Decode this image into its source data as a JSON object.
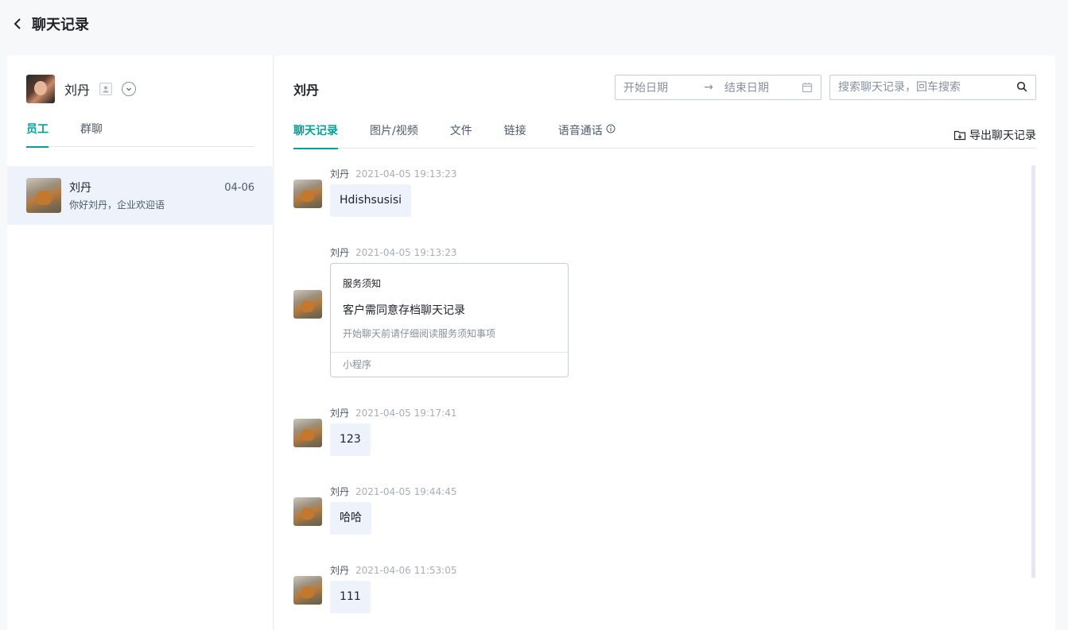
{
  "header": {
    "title": "聊天记录"
  },
  "sidebar": {
    "user_name": "刘丹",
    "tabs": [
      {
        "label": "员工",
        "active": true
      },
      {
        "label": "群聊",
        "active": false
      }
    ],
    "contacts": [
      {
        "name": "刘丹",
        "date": "04-06",
        "preview": "你好刘丹，企业欢迎语"
      }
    ]
  },
  "chat": {
    "title": "刘丹",
    "date_start_placeholder": "开始日期",
    "date_end_placeholder": "结束日期",
    "date_arrow": "→",
    "search_placeholder": "搜索聊天记录，回车搜索",
    "tabs": [
      {
        "label": "聊天记录",
        "active": true
      },
      {
        "label": "图片/视频",
        "active": false
      },
      {
        "label": "文件",
        "active": false
      },
      {
        "label": "链接",
        "active": false
      },
      {
        "label": "语音通话",
        "active": false
      }
    ],
    "export_label": "导出聊天记录",
    "messages": [
      {
        "sender": "刘丹",
        "time": "2021-04-05 19:13:23",
        "text": "Hdishsusisi"
      },
      {
        "sender": "刘丹",
        "time": "2021-04-05 19:13:23",
        "card": {
          "label": "服务须知",
          "title": "客户需同意存档聊天记录",
          "desc": "开始聊天前请仔细阅读服务须知事项",
          "footer": "小程序"
        }
      },
      {
        "sender": "刘丹",
        "time": "2021-04-05 19:17:41",
        "text": "123"
      },
      {
        "sender": "刘丹",
        "time": "2021-04-05 19:44:45",
        "text": "哈哈"
      },
      {
        "sender": "刘丹",
        "time": "2021-04-06 11:53:05",
        "text": "111"
      }
    ]
  },
  "colors": {
    "accent": "#00a19a",
    "bubble": "#eef2fa",
    "selected_row": "#eef2fa"
  }
}
